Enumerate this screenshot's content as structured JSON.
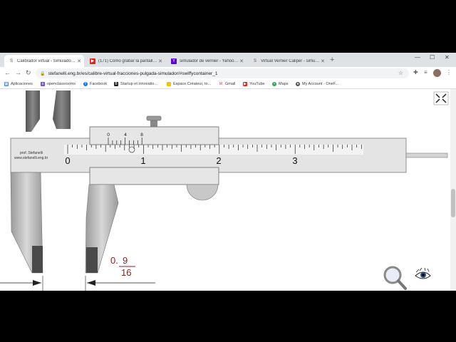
{
  "tabs": [
    {
      "title": "Calibrador virtual - Simulador en",
      "icon": "stefanelli-favicon-icon",
      "active": true
    },
    {
      "title": "(171) Cómo grabar la pantalla de",
      "icon": "youtube-favicon-icon",
      "active": false
    },
    {
      "title": "simulador de vernier - Yahoo Se",
      "icon": "yahoo-favicon-icon",
      "active": false
    },
    {
      "title": "Virtual Vernier Caliper - simulato",
      "icon": "stefanelli-favicon-icon",
      "active": false
    }
  ],
  "address": {
    "url": "stefanelli.eng.br/es/calibre-virtual-fracciones-pulgada-simulador/#swiffycontainer_1"
  },
  "bookmarks": [
    "Aplicaciones",
    "openclassrooms",
    "Facebook",
    "Startup et innovatio...",
    "Espace Créateur, to...",
    "Gmail",
    "YouTube",
    "Maps",
    "My Account - OneF..."
  ],
  "caliper": {
    "author": "prof. Stefanelli",
    "site": "www.stefanelli.eng.br",
    "main_labels": [
      "0",
      "1",
      "2",
      "3"
    ],
    "vernier_labels": [
      "0",
      "4",
      "8"
    ],
    "reading_whole": "0.",
    "reading_numerator": "9",
    "reading_denominator": "16"
  },
  "colors": {
    "reading": "#8b2020",
    "tab_bg": "#dee1e6",
    "caliper_body": "#e4e4e4",
    "jaw_dark": "#4a4a4a"
  }
}
